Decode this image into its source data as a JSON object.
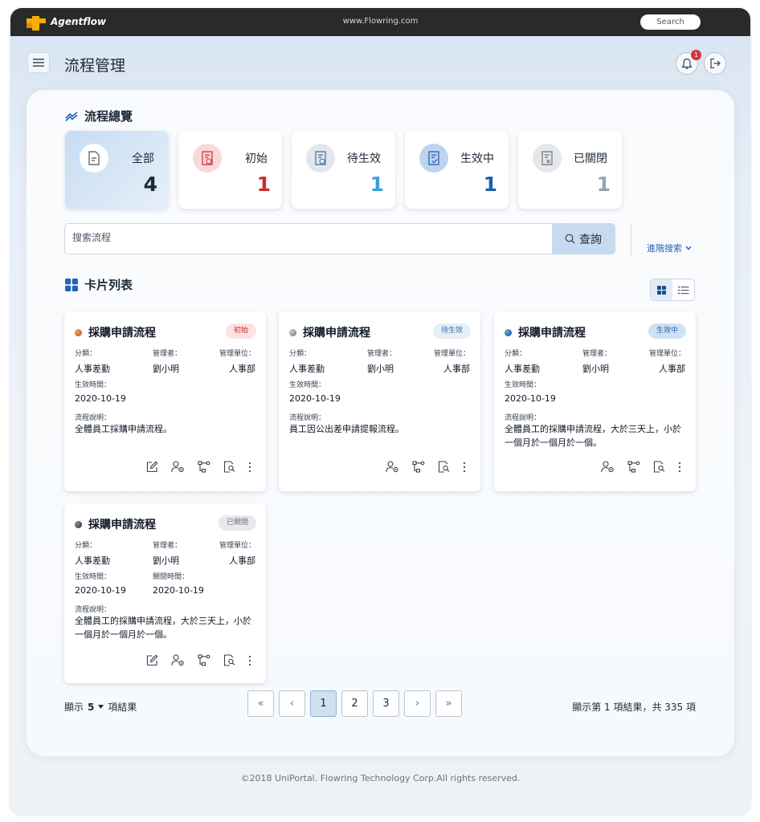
{
  "browser": {
    "app_name": "Agentflow",
    "url": "www.Flowring.com",
    "search_label": "Search"
  },
  "header": {
    "title": "流程管理",
    "notification_count": "1"
  },
  "overview": {
    "title": "流程總覽",
    "stats": [
      {
        "label": "全部",
        "count": "4",
        "color": "#1f2937"
      },
      {
        "label": "初始",
        "count": "1",
        "color": "#c62d35"
      },
      {
        "label": "待生效",
        "count": "1",
        "color": "#3aa0d8"
      },
      {
        "label": "生效中",
        "count": "1",
        "color": "#1d5fa8"
      },
      {
        "label": "已關閉",
        "count": "1",
        "color": "#9aa3ad"
      }
    ]
  },
  "search": {
    "placeholder": "搜索流程",
    "query_label": "查詢",
    "advanced_label": "進階搜索"
  },
  "card_list": {
    "title": "卡片列表",
    "cards": [
      {
        "title": "採購申請流程",
        "status": "初始",
        "category_label": "分類：",
        "category": "人事差勤",
        "manager_label": "管理者：",
        "manager": "劉小明",
        "unit_label": "管理單位：",
        "unit": "人事部",
        "effective_label": "生效時間：",
        "effective": "2020-10-19",
        "desc_label": "流程說明：",
        "desc": "全體員工採購申請流程。"
      },
      {
        "title": "採購申請流程",
        "status": "待生效",
        "category_label": "分類：",
        "category": "人事差勤",
        "manager_label": "管理者：",
        "manager": "劉小明",
        "unit_label": "管理單位：",
        "unit": "人事部",
        "effective_label": "生效時間：",
        "effective": "2020-10-19",
        "desc_label": "流程說明：",
        "desc": "員工因公出差申請提報流程。"
      },
      {
        "title": "採購申請流程",
        "status": "生效中",
        "category_label": "分類：",
        "category": "人事差勤",
        "manager_label": "管理者：",
        "manager": "劉小明",
        "unit_label": "管理單位：",
        "unit": "人事部",
        "effective_label": "生效時間：",
        "effective": "2020-10-19",
        "desc_label": "流程說明：",
        "desc": "全體員工的採購申請流程，大於三天上，小於一個月於一個月於一個。"
      },
      {
        "title": "採購申請流程",
        "status": "已關閉",
        "category_label": "分類：",
        "category": "人事差勤",
        "manager_label": "管理者：",
        "manager": "劉小明",
        "unit_label": "管理單位：",
        "unit": "人事部",
        "effective_label": "生效時間：",
        "effective": "2020-10-19",
        "closed_label": "關閉時間：",
        "closed": "2020-10-19",
        "desc_label": "流程說明：",
        "desc": "全體員工的採購申請流程，大於三天上，小於一個月於一個月於一個。"
      }
    ]
  },
  "pagination": {
    "show_prefix": "顯示",
    "page_size": "5",
    "show_suffix": "項結果",
    "first": "«",
    "prev": "‹",
    "pages": [
      "1",
      "2",
      "3"
    ],
    "next": "›",
    "last": "»",
    "summary": "顯示第 1 項結果，共 335 項"
  },
  "footer": {
    "text": "©2018 UniPortal. Flowring Technology Corp.All rights reserved."
  }
}
